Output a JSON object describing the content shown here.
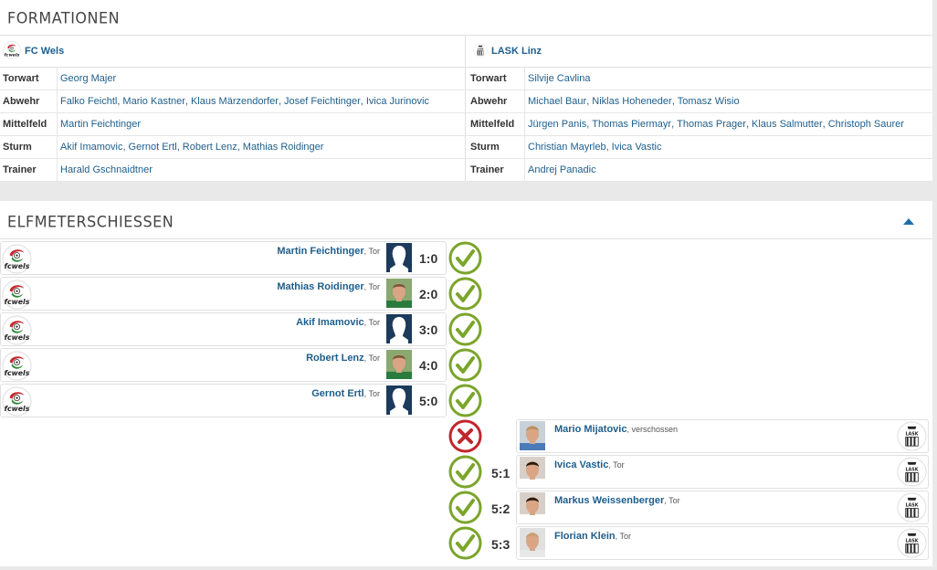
{
  "formations": {
    "title": "FORMATIONEN",
    "home": {
      "team": "FC Wels",
      "rows": [
        {
          "label": "Torwart",
          "players": [
            "Georg Majer"
          ]
        },
        {
          "label": "Abwehr",
          "players": [
            "Falko Feichtl",
            "Mario Kastner",
            "Klaus Märzendorfer",
            "Josef Feichtinger",
            "Ivica Jurinovic"
          ]
        },
        {
          "label": "Mittelfeld",
          "players": [
            "Martin Feichtinger"
          ]
        },
        {
          "label": "Sturm",
          "players": [
            "Akif Imamovic",
            "Gernot Ertl",
            "Robert Lenz",
            "Mathias Roidinger"
          ]
        },
        {
          "label": "Trainer",
          "players": [
            "Harald Gschnaidtner"
          ]
        }
      ]
    },
    "away": {
      "team": "LASK Linz",
      "rows": [
        {
          "label": "Torwart",
          "players": [
            "Silvije Cavlina"
          ]
        },
        {
          "label": "Abwehr",
          "players": [
            "Michael Baur",
            "Niklas Hoheneder",
            "Tomasz Wisio"
          ]
        },
        {
          "label": "Mittelfeld",
          "players": [
            "Jürgen Panis",
            "Thomas Piermayr",
            "Thomas Prager",
            "Klaus Salmutter",
            "Christoph Saurer"
          ]
        },
        {
          "label": "Sturm",
          "players": [
            "Christian Mayrleb",
            "Ivica Vastic"
          ]
        },
        {
          "label": "Trainer",
          "players": [
            "Andrej Panadic"
          ]
        }
      ]
    }
  },
  "penalties": {
    "title": "ELFMETERSCHIESSEN",
    "shots": [
      {
        "side": "home",
        "player": "Martin Feichtinger",
        "note": ", Tor",
        "score": "1:0",
        "result": "goal",
        "photo": "placeholder"
      },
      {
        "side": "home",
        "player": "Mathias Roidinger",
        "note": ", Tor",
        "score": "2:0",
        "result": "goal",
        "photo": "green-shirt"
      },
      {
        "side": "home",
        "player": "Akif Imamovic",
        "note": ", Tor",
        "score": "3:0",
        "result": "goal",
        "photo": "placeholder"
      },
      {
        "side": "home",
        "player": "Robert Lenz",
        "note": ", Tor",
        "score": "4:0",
        "result": "goal",
        "photo": "green-shirt"
      },
      {
        "side": "home",
        "player": "Gernot Ertl",
        "note": ", Tor",
        "score": "5:0",
        "result": "goal",
        "photo": "placeholder"
      },
      {
        "side": "away",
        "player": "Mario Mijatovic",
        "note": ", verschossen",
        "score": "",
        "result": "miss",
        "photo": "blue-shirt"
      },
      {
        "side": "away",
        "player": "Ivica Vastic",
        "note": ", Tor",
        "score": "5:1",
        "result": "goal",
        "photo": "dark-hair"
      },
      {
        "side": "away",
        "player": "Markus Weissenberger",
        "note": ", Tor",
        "score": "5:2",
        "result": "goal",
        "photo": "dark-hair"
      },
      {
        "side": "away",
        "player": "Florian Klein",
        "note": ", Tor",
        "score": "5:3",
        "result": "goal",
        "photo": "light-hair"
      }
    ]
  },
  "colors": {
    "link": "#1e5e8c",
    "goal": "#7ba52b",
    "miss": "#c0262d",
    "accent": "#1e6fa8"
  },
  "icons": {
    "home_logo": "fc-wels-logo",
    "away_logo": "lask-logo",
    "goal": "check-icon",
    "miss": "cross-icon",
    "collapse": "chevron-up-icon"
  }
}
